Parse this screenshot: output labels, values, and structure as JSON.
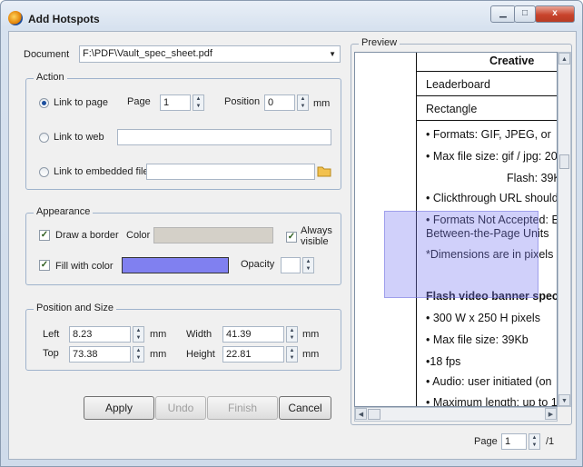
{
  "window": {
    "title": "Add Hotspots",
    "controls": {
      "minimize": "▁",
      "maximize": "□",
      "close": "x"
    }
  },
  "document": {
    "label": "Document",
    "value": "F:\\PDF\\Vault_spec_sheet.pdf"
  },
  "action": {
    "legend": "Action",
    "link_to_page": "Link to page",
    "page_label": "Page",
    "page_value": "1",
    "position_label": "Position",
    "position_value": "0",
    "position_unit": "mm",
    "link_to_web": "Link to web",
    "web_value": "",
    "link_to_file": "Link to embedded file",
    "file_value": "",
    "selected": "link_to_page"
  },
  "appearance": {
    "legend": "Appearance",
    "draw_border": "Draw a border",
    "color_label": "Color",
    "border_color": "#d4d0c8",
    "always_visible": "Always visible",
    "fill_with_color": "Fill with color",
    "fill_color": "#8080f0",
    "opacity_label": "Opacity",
    "opacity_value": ""
  },
  "position_size": {
    "legend": "Position and Size",
    "left_label": "Left",
    "left_value": "8.23",
    "top_label": "Top",
    "top_value": "73.38",
    "width_label": "Width",
    "width_value": "41.39",
    "height_label": "Height",
    "height_value": "22.81",
    "unit": "mm"
  },
  "buttons": {
    "apply": "Apply",
    "undo": "Undo",
    "finish": "Finish",
    "cancel": "Cancel"
  },
  "preview": {
    "legend": "Preview",
    "header": "Creative",
    "row1": "Leaderboard",
    "row2": "Rectangle",
    "lines": [
      "• Formats: GIF, JPEG, or",
      "• Max file size:  gif / jpg: 20",
      "Flash: 39K",
      "• Clickthrough URL should",
      "• Formats Not Accepted: E",
      "Between-the-Page Units",
      "*Dimensions are in pixels",
      "Flash video banner spec",
      "• 300 W x 250 H pixels",
      "• Max file size: 39Kb",
      "•18 fps",
      "• Audio: user initiated (on",
      "• Maximum length: up to 1"
    ]
  },
  "pager": {
    "label": "Page",
    "value": "1",
    "total": "/1"
  }
}
